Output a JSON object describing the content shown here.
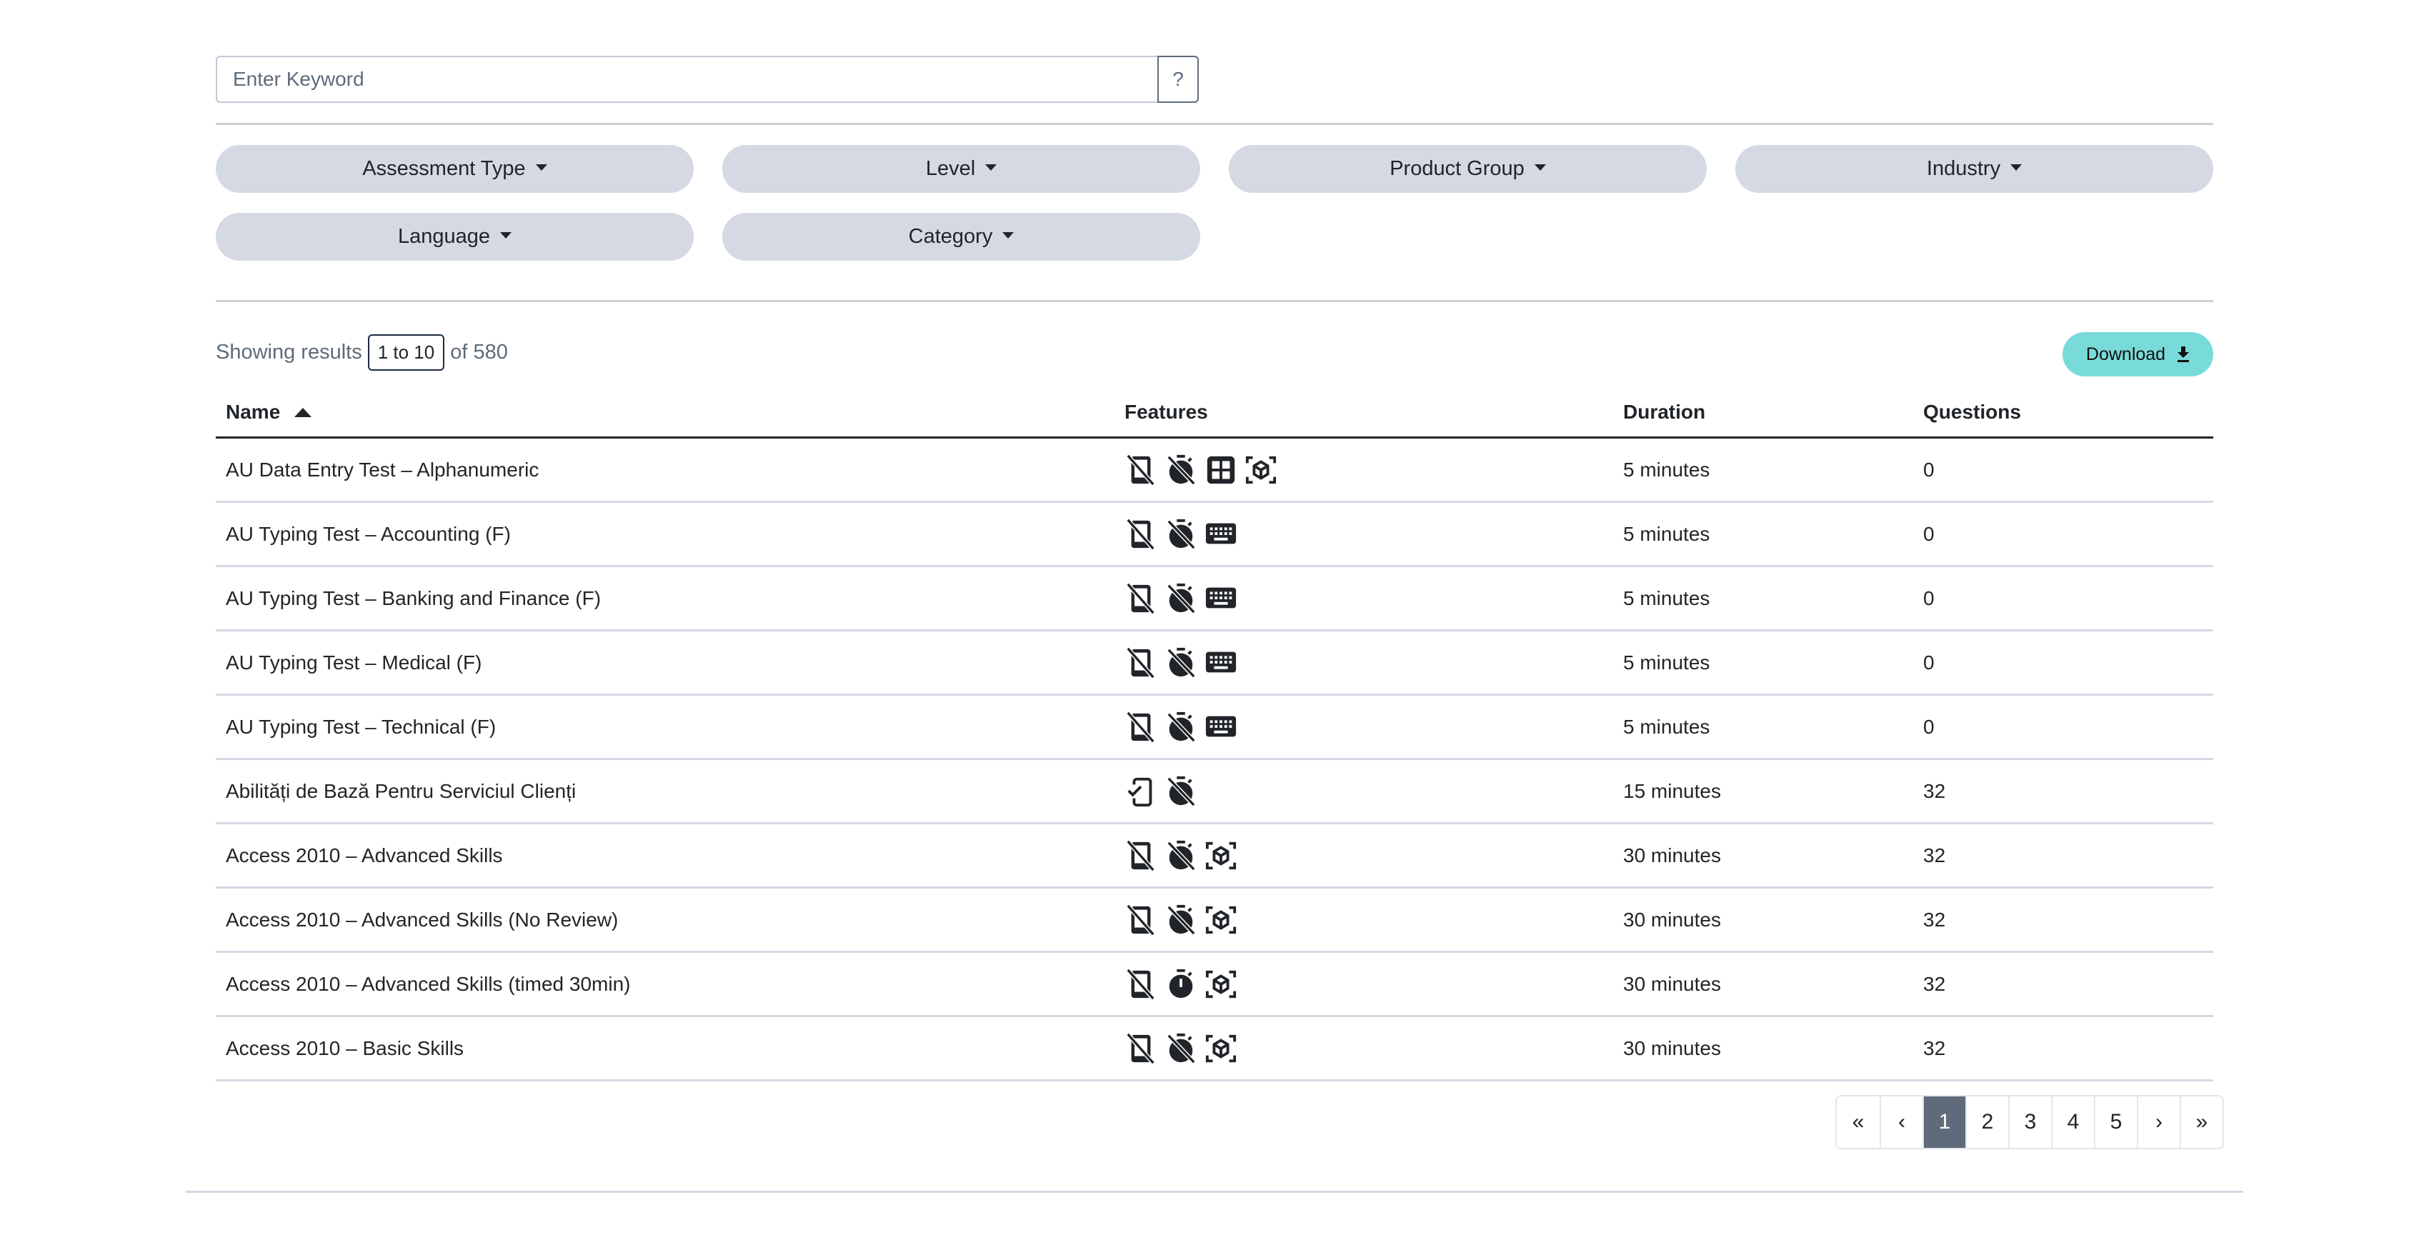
{
  "search": {
    "placeholder": "Enter Keyword",
    "value": "",
    "help_label": "?"
  },
  "filters": [
    {
      "label": "Assessment Type"
    },
    {
      "label": "Level"
    },
    {
      "label": "Product Group"
    },
    {
      "label": "Industry"
    },
    {
      "label": "Language"
    },
    {
      "label": "Category"
    }
  ],
  "results": {
    "prefix": "Showing results",
    "range": "1 to 10",
    "suffix": "of 580"
  },
  "download": {
    "label": "Download",
    "icon": "download-icon"
  },
  "colors": {
    "accent": "#79dbd9",
    "pill": "#d5d9e4",
    "active_page": "#5f6b7a",
    "text": "#212529",
    "muted": "#5f6b7a"
  },
  "table": {
    "columns": [
      {
        "label": "Name",
        "sort": "ascending"
      },
      {
        "label": "Features"
      },
      {
        "label": "Duration"
      },
      {
        "label": "Questions"
      }
    ],
    "rows": [
      {
        "name": "AU Data Entry Test – Alphanumeric",
        "features": [
          "mobile-off",
          "timer-off",
          "grid",
          "cube-scan"
        ],
        "duration": "5 minutes",
        "questions": "0"
      },
      {
        "name": "AU Typing Test – Accounting (F)",
        "features": [
          "mobile-off",
          "timer-off",
          "keyboard"
        ],
        "duration": "5 minutes",
        "questions": "0"
      },
      {
        "name": "AU Typing Test – Banking and Finance (F)",
        "features": [
          "mobile-off",
          "timer-off",
          "keyboard"
        ],
        "duration": "5 minutes",
        "questions": "0"
      },
      {
        "name": "AU Typing Test – Medical (F)",
        "features": [
          "mobile-off",
          "timer-off",
          "keyboard"
        ],
        "duration": "5 minutes",
        "questions": "0"
      },
      {
        "name": "AU Typing Test – Technical (F)",
        "features": [
          "mobile-off",
          "timer-off",
          "keyboard"
        ],
        "duration": "5 minutes",
        "questions": "0"
      },
      {
        "name": "Abilități de Bază Pentru Serviciul Clienți",
        "features": [
          "mobile-check",
          "timer-off"
        ],
        "duration": "15 minutes",
        "questions": "32"
      },
      {
        "name": "Access 2010 – Advanced Skills",
        "features": [
          "mobile-off",
          "timer-off",
          "cube-scan"
        ],
        "duration": "30 minutes",
        "questions": "32"
      },
      {
        "name": "Access 2010 – Advanced Skills (No Review)",
        "features": [
          "mobile-off",
          "timer-off",
          "cube-scan"
        ],
        "duration": "30 minutes",
        "questions": "32"
      },
      {
        "name": "Access 2010 – Advanced Skills (timed 30min)",
        "features": [
          "mobile-off",
          "timer",
          "cube-scan"
        ],
        "duration": "30 minutes",
        "questions": "32"
      },
      {
        "name": "Access 2010 – Basic Skills",
        "features": [
          "mobile-off",
          "timer-off",
          "cube-scan"
        ],
        "duration": "30 minutes",
        "questions": "32"
      }
    ]
  },
  "pagination": {
    "items": [
      {
        "label": "«",
        "name": "first-page"
      },
      {
        "label": "‹",
        "name": "previous-page"
      },
      {
        "label": "1",
        "name": "page-1",
        "active": true
      },
      {
        "label": "2",
        "name": "page-2"
      },
      {
        "label": "3",
        "name": "page-3"
      },
      {
        "label": "4",
        "name": "page-4"
      },
      {
        "label": "5",
        "name": "page-5"
      },
      {
        "label": "›",
        "name": "next-page"
      },
      {
        "label": "»",
        "name": "last-page"
      }
    ],
    "current": 1
  }
}
